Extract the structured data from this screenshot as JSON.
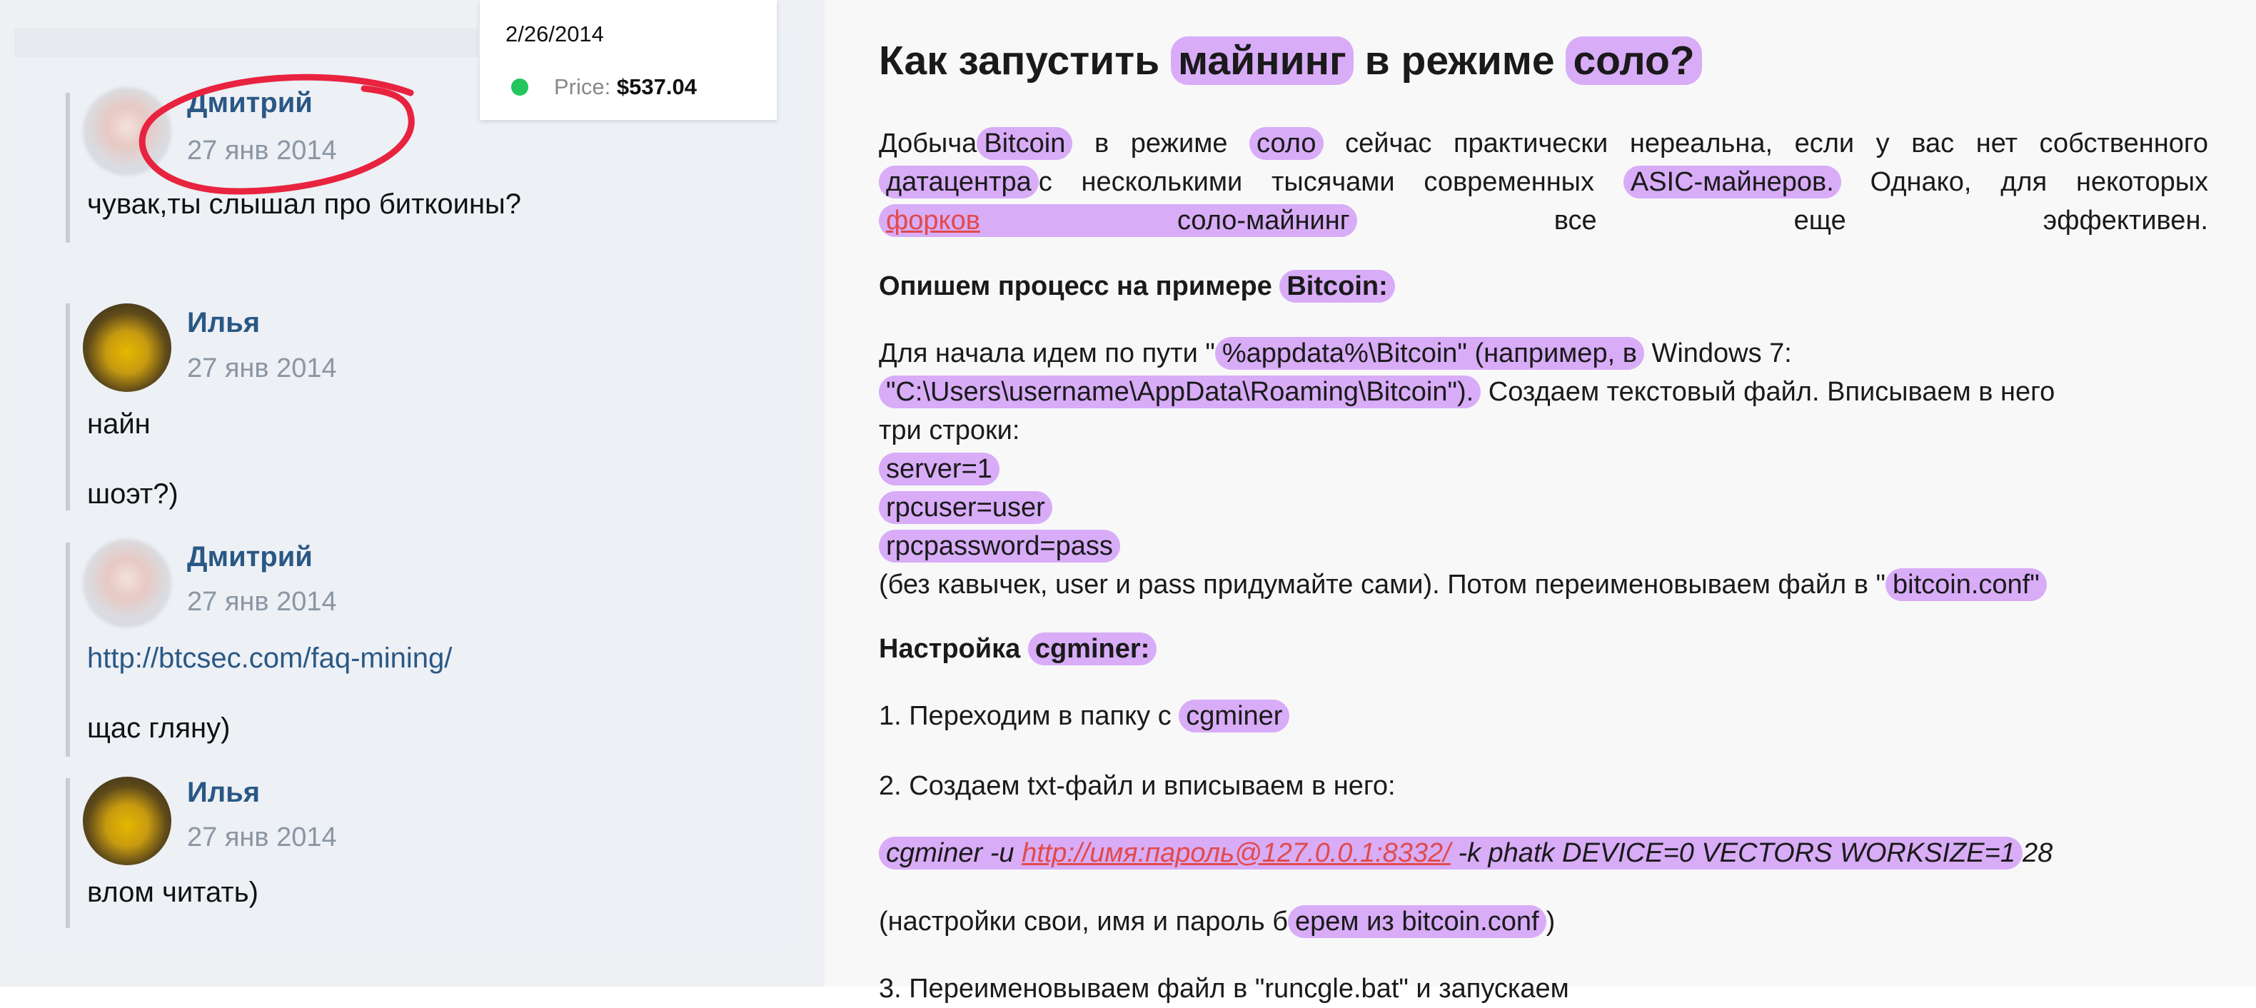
{
  "tooltip": {
    "date": "2/26/2014",
    "price_label": "Price:",
    "price_value": "$537.04",
    "dot_color": "#22c55e"
  },
  "chat": {
    "messages": [
      {
        "author": "Дмитрий",
        "date": "27 янв 2014",
        "lines": [
          "чувак,ты слышал про биткоины?"
        ]
      },
      {
        "author": "Илья",
        "date": "27 янв 2014",
        "lines": [
          "найн",
          "шоэт?)"
        ]
      },
      {
        "author": "Дмитрий",
        "date": "27 янв 2014",
        "lines": [
          "http://btcsec.com/faq-mining/",
          "щас гляну)"
        ]
      },
      {
        "author": "Илья",
        "date": "27 янв 2014",
        "lines": [
          "влом читать)"
        ]
      }
    ],
    "annotation_color": "#e8233f"
  },
  "article": {
    "title_parts": [
      "Как запустить",
      "майнинг",
      "в режиме",
      "соло?"
    ],
    "p1_parts": [
      "Добыча",
      "Bitcoin",
      "в режиме",
      "соло",
      "сейчас практически нереальна, если у вас нет собственного",
      "датацентра",
      "с несколькими тысячами современных",
      "ASIC-майнеров.",
      "Однако, для некоторых",
      "форков",
      "соло-майнинг",
      "все еще эффективен."
    ],
    "p2_parts": [
      "Опишем процесс на примере",
      "Bitcoin:"
    ],
    "p3_parts": [
      "Для начала идем по пути \"",
      "%appdata%\\Bitcoin\" (например, в",
      "Windows 7:",
      "\"C:\\Users\\username\\AppData\\Roaming\\Bitcoin\").",
      "Создаем текстовый файл. Вписываем в него",
      "три строки:"
    ],
    "config_lines": [
      "server=1",
      "rpcuser=user",
      "rpcpassword=pass"
    ],
    "p4_parts": [
      "(без кавычек, user и pass придумайте сами). Потом переименовываем файл в \"",
      "bitcoin.conf\""
    ],
    "p5_parts": [
      "Настройка",
      "cgminer:"
    ],
    "step1_parts": [
      "1. Переходим в папку с",
      "cgminer"
    ],
    "step2": "2. Создаем txt-файл и вписываем в него:",
    "cmd_parts": [
      "cgminer -u",
      "http://имя:пароль@127.0.0.1:8332/",
      "-k phatk DEVICE=0 VECTORS WORKSIZE=1",
      "28"
    ],
    "note_parts": [
      "(настройки свои, имя и пароль б",
      "ерем из bitcoin.conf",
      ")"
    ],
    "step3": "3. Переименовываем файл в \"runcgle.bat\" и запускаем"
  }
}
